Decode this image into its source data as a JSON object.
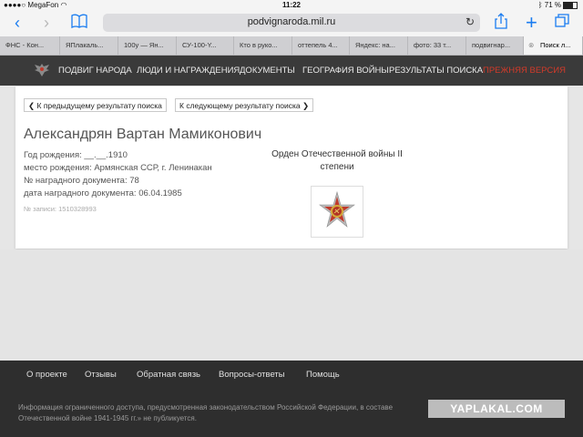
{
  "status": {
    "carrier": "MegaFon",
    "time": "11:22",
    "battery": "71 %"
  },
  "browser": {
    "url": "podvignaroda.mil.ru"
  },
  "tabs": [
    "ФНС - Кон...",
    "ЯПлакаль...",
    "100у — Ян...",
    "СУ-100-Y...",
    "Кто в руко...",
    "оттепель 4...",
    "Яндекс: на...",
    "фото: 33 т...",
    "подвигнар...",
    "Поиск л..."
  ],
  "header": {
    "menu": [
      "ПОДВИГ НАРОДА",
      "ЛЮДИ И НАГРАЖДЕНИЯ",
      "ДОКУМЕНТЫ",
      "ГЕОГРАФИЯ ВОЙНЫ",
      "РЕЗУЛЬТАТЫ ПОИСКА",
      "ПРЕЖНЯЯ ВЕРСИЯ"
    ]
  },
  "pager": {
    "prev": "К предыдущему результату поиска",
    "next": "К следующему результату поиска"
  },
  "person": {
    "name": "Александрян Вартан Мамиконович",
    "birth_year": "Год рождения: __.__.1910",
    "birth_place": "место рождения: Армянская ССР, г. Ленинакан",
    "doc_number": "№ наградного документа: 78",
    "doc_date": "дата наградного документа: 06.04.1985",
    "record": "№ записи: 1510328993"
  },
  "award": {
    "line1": "Орден Отечественной войны II",
    "line2": "степени"
  },
  "footer": {
    "links": [
      "О проекте",
      "Отзывы",
      "Обратная связь",
      "Вопросы-ответы",
      "Помощь"
    ],
    "text_line1": "Информация ограниченного доступа, предусмотренная законодательством Российской Федерации, в составе",
    "text_line2": "Отечественной войне 1941-1945 гг.» не публикуется."
  },
  "watermark": "YAPLAKAL.COM"
}
